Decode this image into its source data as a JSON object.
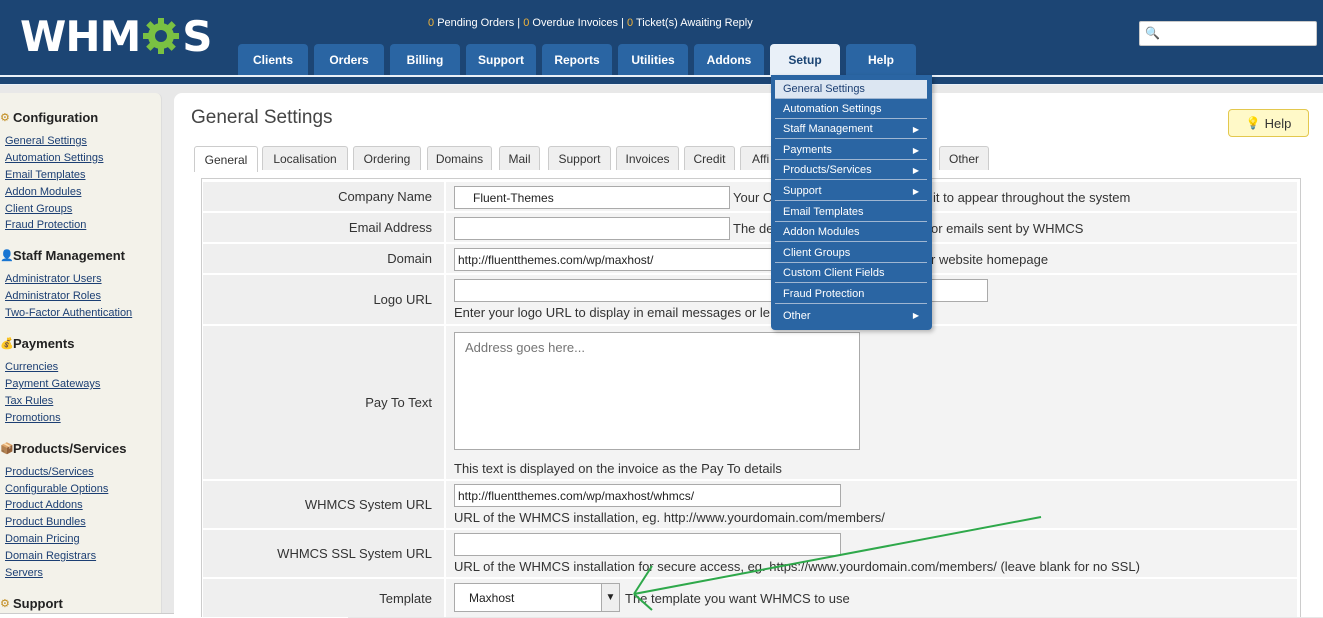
{
  "header": {
    "logo_text_left": "WHM",
    "logo_text_right": "S",
    "status": {
      "pending_orders_count": "0",
      "pending_orders_label": "Pending Orders",
      "sep1": " | ",
      "overdue_count": "0",
      "overdue_label": "Overdue Invoices",
      "sep2": " | ",
      "tickets_count": "0",
      "tickets_label": "Ticket(s) Awaiting Reply"
    },
    "search_icon": "🔍",
    "search_value": ""
  },
  "nav": {
    "tabs": [
      {
        "label": "Clients"
      },
      {
        "label": "Orders"
      },
      {
        "label": "Billing"
      },
      {
        "label": "Support"
      },
      {
        "label": "Reports"
      },
      {
        "label": "Utilities"
      },
      {
        "label": "Addons"
      },
      {
        "label": "Setup"
      },
      {
        "label": "Help"
      }
    ],
    "active": "Setup"
  },
  "setup_menu": {
    "items": [
      {
        "label": "General Settings",
        "arrow": ""
      },
      {
        "label": "Automation Settings",
        "arrow": ""
      },
      {
        "label": "Staff Management",
        "arrow": "▶"
      },
      {
        "label": "Payments",
        "arrow": "▶"
      },
      {
        "label": "Products/Services",
        "arrow": "▶"
      },
      {
        "label": "Support",
        "arrow": "▶"
      },
      {
        "label": "Email Templates",
        "arrow": ""
      },
      {
        "label": "Addon Modules",
        "arrow": ""
      },
      {
        "label": "Client Groups",
        "arrow": ""
      },
      {
        "label": "Custom Client Fields",
        "arrow": ""
      },
      {
        "label": "Fraud Protection",
        "arrow": ""
      },
      {
        "label": "Other",
        "arrow": "▶"
      }
    ]
  },
  "sidebar": {
    "sections": [
      {
        "heading": "Configuration",
        "icon": "⚙",
        "links": [
          "General Settings",
          "Automation Settings",
          "Email Templates",
          "Addon Modules",
          "Client Groups",
          "Fraud Protection"
        ]
      },
      {
        "heading": "Staff Management",
        "icon": "👤",
        "links": [
          "Administrator Users",
          "Administrator Roles",
          "Two-Factor Authentication"
        ]
      },
      {
        "heading": "Payments",
        "icon": "💰",
        "links": [
          "Currencies",
          "Payment Gateways",
          "Tax Rules",
          "Promotions"
        ]
      },
      {
        "heading": "Products/Services",
        "icon": "📦",
        "links": [
          "Products/Services",
          "Configurable Options",
          "Product Addons",
          "Product Bundles",
          "Domain Pricing",
          "Domain Registrars",
          "Servers"
        ]
      },
      {
        "heading": "Support",
        "icon": "⚙",
        "links": []
      }
    ]
  },
  "main": {
    "title": "General Settings",
    "help_label": "Help",
    "tabs": [
      {
        "label": "General"
      },
      {
        "label": "Localisation"
      },
      {
        "label": "Ordering"
      },
      {
        "label": "Domains"
      },
      {
        "label": "Mail"
      },
      {
        "label": "Support"
      },
      {
        "label": "Invoices"
      },
      {
        "label": "Credit"
      },
      {
        "label": "Affi"
      },
      {
        "label": "Other"
      }
    ],
    "form": {
      "company_name": {
        "label": "Company Name",
        "value": "Fluent-Themes",
        "desc_left": "Your C",
        "desc_right": "it to appear throughout the system"
      },
      "email_address": {
        "label": "Email Address",
        "value": "",
        "desc_left": "The de",
        "desc_right": "or emails sent by WHMCS"
      },
      "domain": {
        "label": "Domain",
        "value": "http://fluentthemes.com/wp/maxhost/",
        "desc_right": "r website homepage"
      },
      "logo_url": {
        "label": "Logo URL",
        "value": "",
        "desc": "Enter your logo URL to display in email messages or le"
      },
      "pay_to_text": {
        "label": "Pay To Text",
        "placeholder": "Address goes here...",
        "desc": "This text is displayed on the invoice as the Pay To details"
      },
      "system_url": {
        "label": "WHMCS System URL",
        "value": "http://fluentthemes.com/wp/maxhost/whmcs/",
        "desc": "URL of the WHMCS installation, eg. http://www.yourdomain.com/members/"
      },
      "ssl_url": {
        "label": "WHMCS SSL System URL",
        "value": "",
        "desc": "URL of the WHMCS installation for secure access, eg. https://www.yourdomain.com/members/ (leave blank for no SSL)"
      },
      "template": {
        "label": "Template",
        "value": "Maxhost",
        "desc": "The template you want WHMCS to use"
      }
    }
  },
  "colors": {
    "header_bg": "#1c4574",
    "nav_tab": "#2a65a3",
    "status_count": "#f0b33a",
    "annotation_arrow": "#2ea84a"
  }
}
